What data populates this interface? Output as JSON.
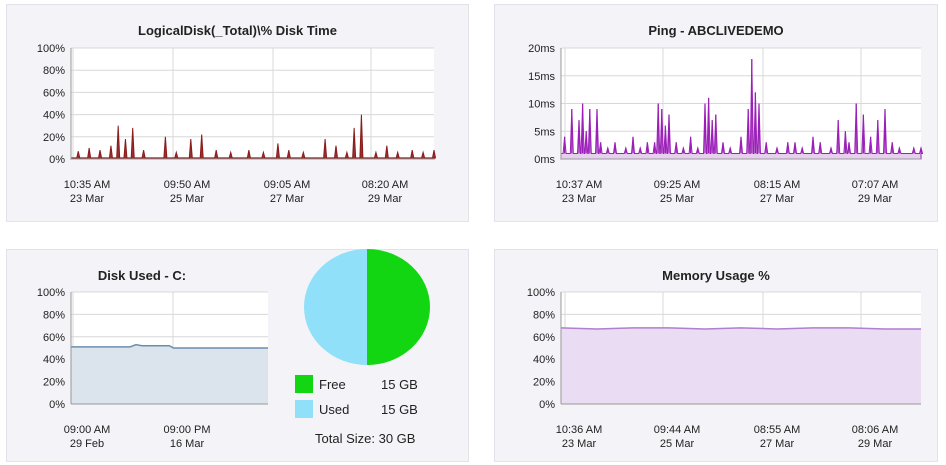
{
  "charts": {
    "disktime": {
      "title": "LogicalDisk(_Total)\\% Disk Time",
      "color": "#8b1a1a",
      "fill": "#8b1a1a",
      "yticks": [
        "0%",
        "20%",
        "40%",
        "60%",
        "80%",
        "100%"
      ],
      "xticks": [
        [
          "10:35 AM",
          "23 Mar"
        ],
        [
          "09:50 AM",
          "25 Mar"
        ],
        [
          "09:05 AM",
          "27 Mar"
        ],
        [
          "08:20 AM",
          "29 Mar"
        ]
      ]
    },
    "ping": {
      "title": "Ping - ABCLIVEDEMO",
      "color": "#9b1fb8",
      "fill": "#e7d0ee",
      "yticks": [
        "0ms",
        "5ms",
        "10ms",
        "15ms",
        "20ms"
      ],
      "xticks": [
        [
          "10:37 AM",
          "23 Mar"
        ],
        [
          "09:25 AM",
          "25 Mar"
        ],
        [
          "08:15 AM",
          "27 Mar"
        ],
        [
          "07:07 AM",
          "29 Mar"
        ]
      ]
    },
    "diskused": {
      "title": "Disk Used - C:",
      "color": "#6a8fae",
      "fill": "#dbe4ec",
      "yticks": [
        "0%",
        "20%",
        "40%",
        "60%",
        "80%",
        "100%"
      ],
      "xticks": [
        [
          "09:00 AM",
          "29 Feb"
        ],
        [
          "09:00 PM",
          "16 Mar"
        ]
      ]
    },
    "memory": {
      "title": "Memory Usage %",
      "color": "#b07fd0",
      "fill": "#eadcf3",
      "yticks": [
        "0%",
        "20%",
        "40%",
        "60%",
        "80%",
        "100%"
      ],
      "xticks": [
        [
          "10:36 AM",
          "23 Mar"
        ],
        [
          "09:44 AM",
          "25 Mar"
        ],
        [
          "08:55 AM",
          "27 Mar"
        ],
        [
          "08:06 AM",
          "29 Mar"
        ]
      ]
    }
  },
  "pie": {
    "free_label": "Free",
    "free_value": "15 GB",
    "free_color": "#11d611",
    "used_label": "Used",
    "used_value": "15 GB",
    "used_color": "#8fe0f8",
    "total": "Total Size: 30 GB"
  },
  "chart_data": [
    {
      "type": "area",
      "title": "LogicalDisk(_Total)\\% Disk Time",
      "ylim": [
        0,
        100
      ],
      "x_ticks": [
        "10:35 AM 23 Mar",
        "09:50 AM 25 Mar",
        "09:05 AM 27 Mar",
        "08:20 AM 29 Mar"
      ],
      "spikes": [
        [
          0.02,
          7
        ],
        [
          0.05,
          10
        ],
        [
          0.08,
          8
        ],
        [
          0.11,
          12
        ],
        [
          0.13,
          30
        ],
        [
          0.15,
          18
        ],
        [
          0.17,
          28
        ],
        [
          0.2,
          8
        ],
        [
          0.26,
          20
        ],
        [
          0.29,
          6
        ],
        [
          0.33,
          18
        ],
        [
          0.36,
          22
        ],
        [
          0.4,
          8
        ],
        [
          0.44,
          6
        ],
        [
          0.49,
          8
        ],
        [
          0.53,
          6
        ],
        [
          0.57,
          14
        ],
        [
          0.6,
          8
        ],
        [
          0.64,
          6
        ],
        [
          0.7,
          18
        ],
        [
          0.73,
          12
        ],
        [
          0.76,
          6
        ],
        [
          0.78,
          28
        ],
        [
          0.8,
          40
        ],
        [
          0.84,
          6
        ],
        [
          0.87,
          12
        ],
        [
          0.9,
          6
        ],
        [
          0.94,
          8
        ],
        [
          0.97,
          6
        ],
        [
          1.0,
          8
        ]
      ],
      "baseline": 1
    },
    {
      "type": "line",
      "title": "Ping - ABCLIVEDEMO",
      "ylim": [
        0,
        20
      ],
      "x_ticks": [
        "10:37 AM 23 Mar",
        "09:25 AM 25 Mar",
        "08:15 AM 27 Mar",
        "07:07 AM 29 Mar"
      ],
      "spikes": [
        [
          0.01,
          4
        ],
        [
          0.03,
          9
        ],
        [
          0.05,
          7
        ],
        [
          0.06,
          10
        ],
        [
          0.07,
          5
        ],
        [
          0.08,
          9
        ],
        [
          0.1,
          9
        ],
        [
          0.11,
          3
        ],
        [
          0.13,
          2
        ],
        [
          0.15,
          3
        ],
        [
          0.18,
          2
        ],
        [
          0.2,
          4
        ],
        [
          0.22,
          2
        ],
        [
          0.24,
          3
        ],
        [
          0.26,
          3
        ],
        [
          0.27,
          10
        ],
        [
          0.28,
          9
        ],
        [
          0.29,
          6
        ],
        [
          0.3,
          8
        ],
        [
          0.32,
          3
        ],
        [
          0.34,
          2
        ],
        [
          0.36,
          4
        ],
        [
          0.38,
          2
        ],
        [
          0.4,
          10
        ],
        [
          0.41,
          11
        ],
        [
          0.42,
          7
        ],
        [
          0.43,
          8
        ],
        [
          0.45,
          3
        ],
        [
          0.47,
          2
        ],
        [
          0.5,
          4
        ],
        [
          0.52,
          9
        ],
        [
          0.53,
          18
        ],
        [
          0.54,
          12
        ],
        [
          0.55,
          10
        ],
        [
          0.57,
          3
        ],
        [
          0.6,
          2
        ],
        [
          0.63,
          3
        ],
        [
          0.65,
          3
        ],
        [
          0.67,
          2
        ],
        [
          0.7,
          4
        ],
        [
          0.72,
          3
        ],
        [
          0.75,
          2
        ],
        [
          0.77,
          7
        ],
        [
          0.79,
          5
        ],
        [
          0.8,
          3
        ],
        [
          0.82,
          10
        ],
        [
          0.84,
          8
        ],
        [
          0.86,
          4
        ],
        [
          0.88,
          7
        ],
        [
          0.9,
          9
        ],
        [
          0.92,
          3
        ],
        [
          0.94,
          2
        ],
        [
          0.96,
          1
        ],
        [
          0.98,
          2
        ],
        [
          1.0,
          2
        ]
      ],
      "baseline": 1
    },
    {
      "type": "area",
      "title": "Disk Used - C:",
      "ylim": [
        0,
        100
      ],
      "x_ticks": [
        "09:00 AM 29 Feb",
        "09:00 PM 16 Mar"
      ],
      "x": [
        0,
        0.25,
        0.3,
        0.33,
        0.36,
        0.5,
        0.52,
        1
      ],
      "y": [
        51,
        51,
        51,
        53,
        52,
        52,
        50,
        50
      ]
    },
    {
      "type": "area",
      "title": "Memory Usage %",
      "ylim": [
        0,
        100
      ],
      "x_ticks": [
        "10:36 AM 23 Mar",
        "09:44 AM 25 Mar",
        "08:55 AM 27 Mar",
        "08:06 AM 29 Mar"
      ],
      "x": [
        0,
        0.1,
        0.2,
        0.3,
        0.4,
        0.5,
        0.6,
        0.7,
        0.8,
        0.9,
        1
      ],
      "y": [
        68,
        67,
        68,
        68,
        67,
        68,
        67,
        68,
        68,
        67,
        67
      ]
    },
    {
      "type": "pie",
      "labels": [
        "Free",
        "Used"
      ],
      "values": [
        15,
        15
      ],
      "unit": "GB"
    }
  ]
}
